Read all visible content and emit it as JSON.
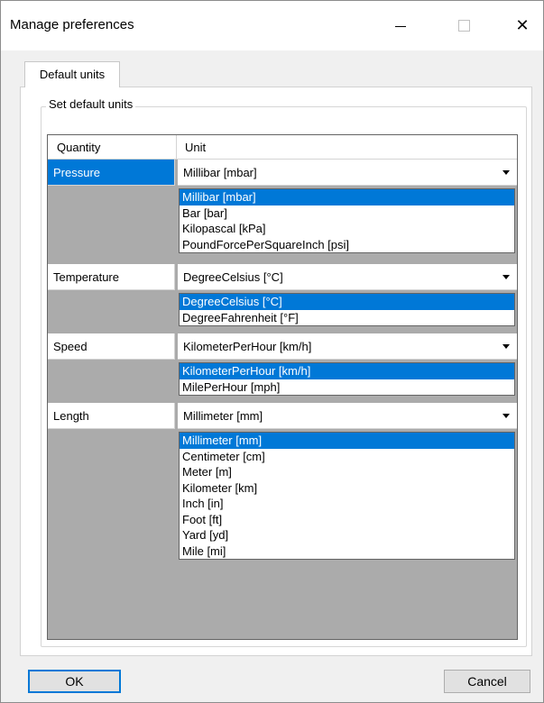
{
  "window": {
    "title": "Manage preferences",
    "controls": {
      "minimize": "minimize-icon",
      "maximize": "maximize-icon",
      "close_glyph": "✕"
    }
  },
  "tabs": [
    {
      "label": "Default units",
      "selected": true
    }
  ],
  "group": {
    "title": "Set default units"
  },
  "grid": {
    "headers": {
      "quantity": "Quantity",
      "unit": "Unit"
    },
    "rows": [
      {
        "quantity": "Pressure",
        "selected": true,
        "value": "Millibar [mbar]",
        "options": [
          "Millibar [mbar]",
          "Bar [bar]",
          "Kilopascal [kPa]",
          "PoundForcePerSquareInch [psi]"
        ]
      },
      {
        "quantity": "Temperature",
        "selected": false,
        "value": "DegreeCelsius [°C]",
        "options": [
          "DegreeCelsius [°C]",
          "DegreeFahrenheit [°F]"
        ]
      },
      {
        "quantity": "Speed",
        "selected": false,
        "value": "KilometerPerHour [km/h]",
        "options": [
          "KilometerPerHour [km/h]",
          "MilePerHour [mph]"
        ]
      },
      {
        "quantity": "Length",
        "selected": false,
        "value": "Millimeter [mm]",
        "options": [
          "Millimeter [mm]",
          "Centimeter [cm]",
          "Meter [m]",
          "Kilometer [km]",
          "Inch [in]",
          "Foot [ft]",
          "Yard [yd]",
          "Mile [mi]"
        ]
      }
    ]
  },
  "buttons": {
    "ok": "OK",
    "cancel": "Cancel"
  },
  "colors": {
    "selection": "#0078d7",
    "grid_background": "#ababab"
  }
}
